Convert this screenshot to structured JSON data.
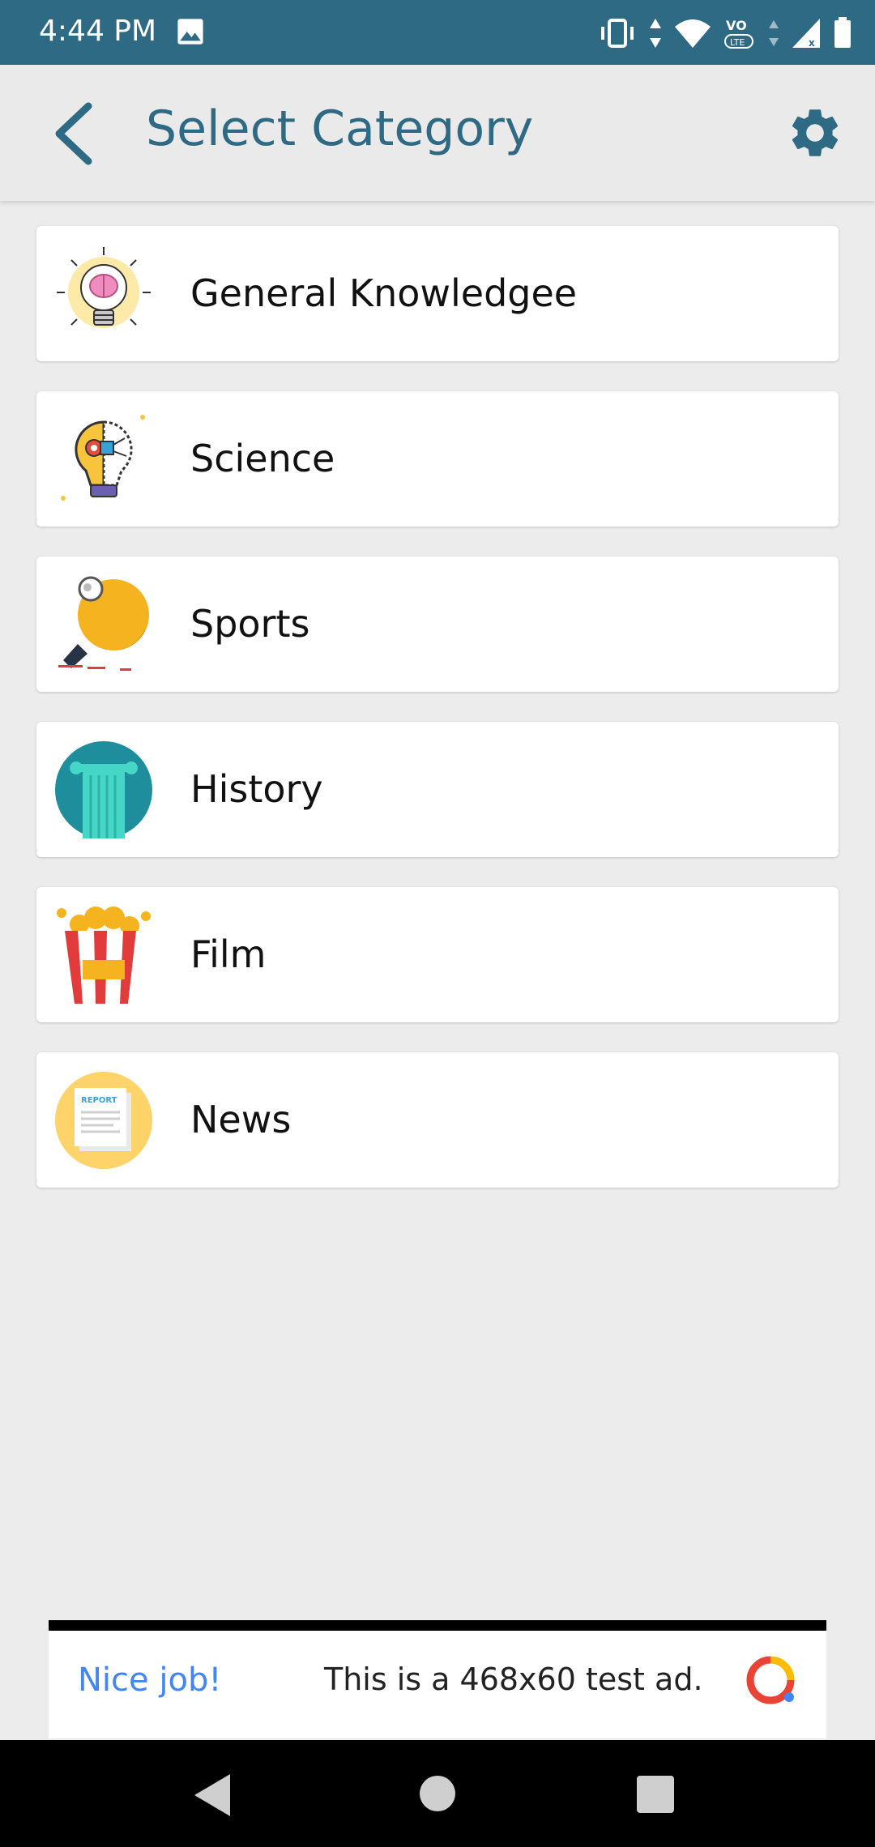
{
  "status_bar": {
    "time": "4:44 PM",
    "icons": [
      "image-icon",
      "vibrate-icon",
      "data-arrows-icon",
      "wifi-icon",
      "volte-icon",
      "signal-icon",
      "battery-icon"
    ]
  },
  "header": {
    "title": "Select Category",
    "back_icon": "back-arrow-icon",
    "settings_icon": "gear-icon",
    "color": "#2f6a85"
  },
  "categories": [
    {
      "label": "General Knowledgee",
      "icon": "lightbulb-brain-icon"
    },
    {
      "label": "Science",
      "icon": "lightbulb-gear-icon"
    },
    {
      "label": "Sports",
      "icon": "ping-pong-icon"
    },
    {
      "label": "History",
      "icon": "column-icon"
    },
    {
      "label": "Film",
      "icon": "popcorn-icon"
    },
    {
      "label": "News",
      "icon": "report-icon"
    }
  ],
  "ad": {
    "title": "Nice job!",
    "text": "This is a 468x60 test ad.",
    "title_color": "#4285f4"
  },
  "nav_bar": {
    "icons": [
      "nav-back-icon",
      "nav-home-icon",
      "nav-recents-icon"
    ]
  }
}
